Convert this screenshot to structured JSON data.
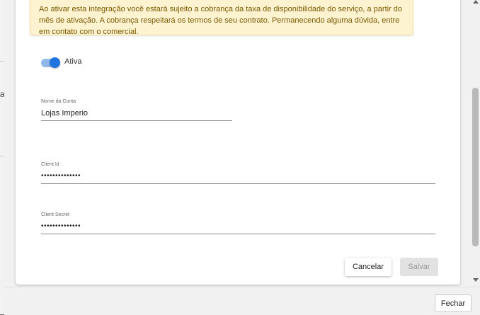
{
  "backdrop": {
    "partial_char": "a"
  },
  "alert": {
    "text": "Ao ativar esta integração você estará sujeito a cobrança da taxa de disponibilidade do serviço, a partir do mês de ativação. A cobrança respeitará os termos de seu contrato. Permanecendo alguma dúvida, entre em contato com o comercial."
  },
  "toggle": {
    "label": "Ativa",
    "checked": true
  },
  "fields": {
    "account_name": {
      "label": "Nome da Conta",
      "value": "Lojas Imperio"
    },
    "client_id": {
      "label": "Client Id",
      "value": "••••••••••••••"
    },
    "client_secret": {
      "label": "Client Secret",
      "value": "••••••••••••••"
    }
  },
  "actions": {
    "cancel": "Cancelar",
    "save": "Salvar"
  },
  "footer": {
    "close": "Fechar"
  },
  "colors": {
    "accent": "#1f74e0",
    "alert_bg": "#fdf3d1",
    "alert_text": "#7a5a00"
  }
}
